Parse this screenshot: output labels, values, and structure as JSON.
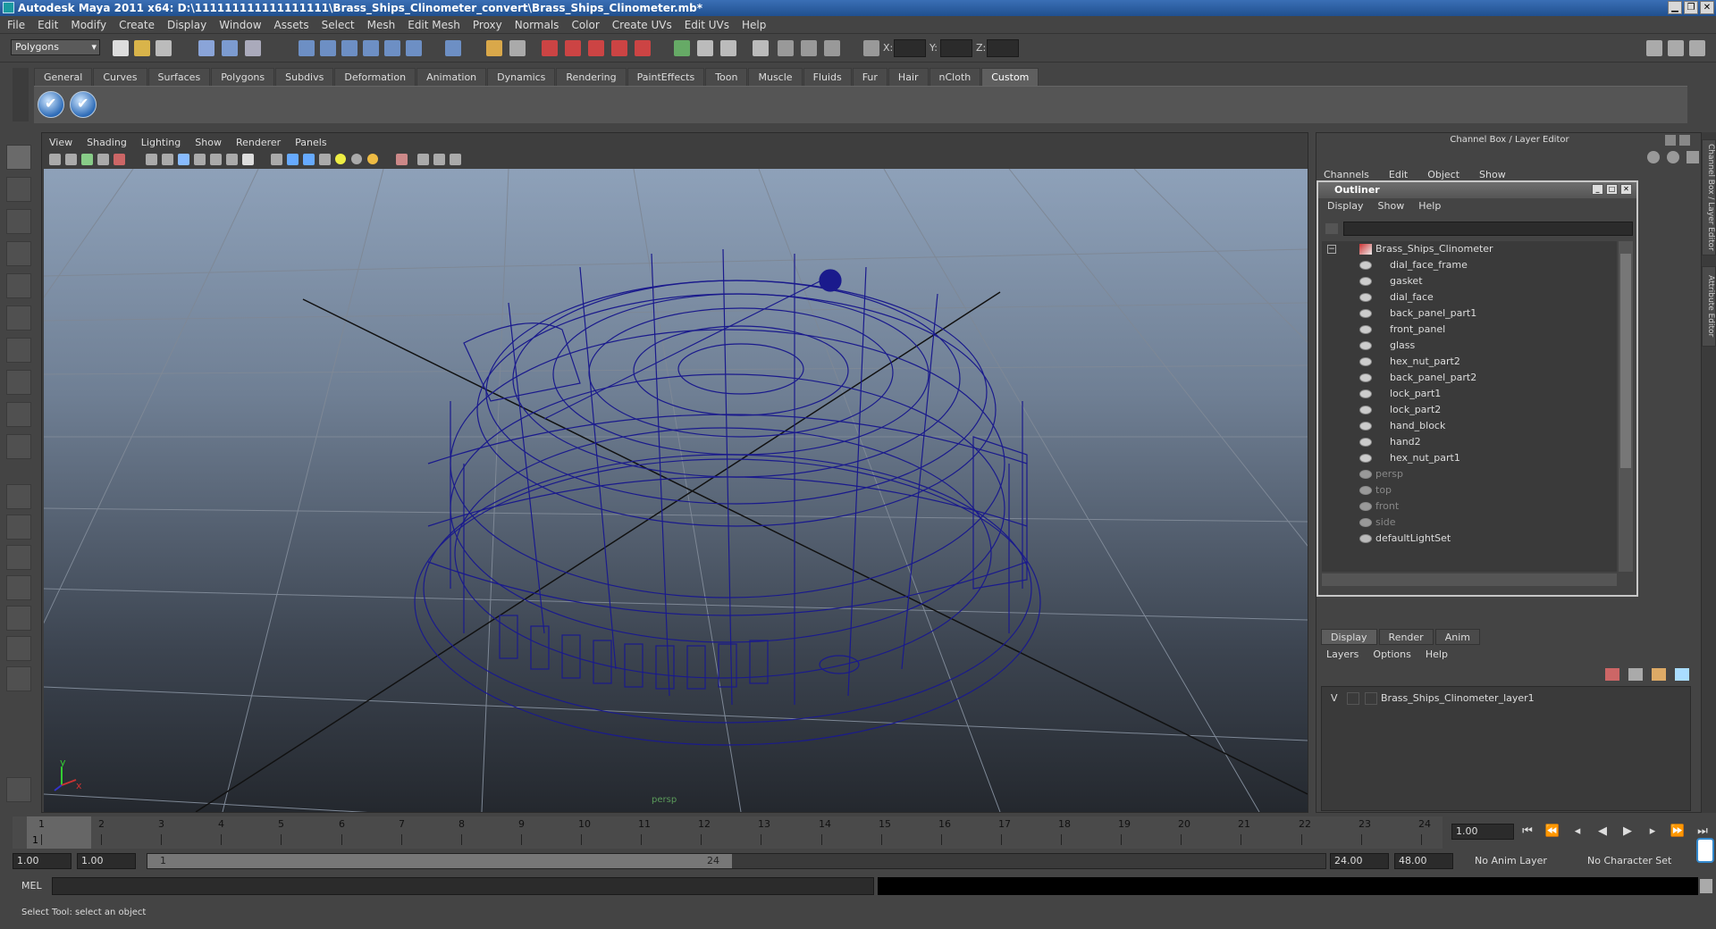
{
  "window": {
    "title": "Autodesk Maya 2011 x64: D:\\111111111111111111\\Brass_Ships_Clinometer_convert\\Brass_Ships_Clinometer.mb*"
  },
  "menubar": [
    "File",
    "Edit",
    "Modify",
    "Create",
    "Display",
    "Window",
    "Assets",
    "Select",
    "Mesh",
    "Edit Mesh",
    "Proxy",
    "Normals",
    "Color",
    "Create UVs",
    "Edit UVs",
    "Help"
  ],
  "status": {
    "mode": "Polygons",
    "x_label": "X:",
    "y_label": "Y:",
    "z_label": "Z:"
  },
  "shelf": {
    "tabs": [
      "General",
      "Curves",
      "Surfaces",
      "Polygons",
      "Subdivs",
      "Deformation",
      "Animation",
      "Dynamics",
      "Rendering",
      "PaintEffects",
      "Toon",
      "Muscle",
      "Fluids",
      "Fur",
      "Hair",
      "nCloth",
      "Custom"
    ],
    "active_tab": "Custom"
  },
  "viewport": {
    "menu": [
      "View",
      "Shading",
      "Lighting",
      "Show",
      "Renderer",
      "Panels"
    ],
    "camera": "persp",
    "axis_y": "y",
    "axis_x": "x",
    "wire_color": "#1a1a8c"
  },
  "channelbox": {
    "title": "Channel Box / Layer Editor",
    "menu": [
      "Channels",
      "Edit",
      "Object",
      "Show"
    ]
  },
  "sidetabs": [
    "Channel Box / Layer Editor",
    "Attribute Editor"
  ],
  "outliner": {
    "title": "Outliner",
    "menu": [
      "Display",
      "Show",
      "Help"
    ],
    "root": "Brass_Ships_Clinometer",
    "children": [
      "dial_face_frame",
      "gasket",
      "dial_face",
      "back_panel_part1",
      "front_panel",
      "glass",
      "hex_nut_part2",
      "back_panel_part2",
      "lock_part1",
      "lock_part2",
      "hand_block",
      "hand2",
      "hex_nut_part1"
    ],
    "cameras": [
      "persp",
      "top",
      "front",
      "side"
    ],
    "extra": "defaultLightSet"
  },
  "layer_editor": {
    "tabs": [
      "Display",
      "Render",
      "Anim"
    ],
    "active_tab": "Display",
    "menu": [
      "Layers",
      "Options",
      "Help"
    ],
    "layer": {
      "visible": "V",
      "name": "Brass_Ships_Clinometer_layer1"
    }
  },
  "timeline": {
    "ticks": [
      "1",
      "2",
      "3",
      "4",
      "5",
      "6",
      "7",
      "8",
      "9",
      "10",
      "11",
      "12",
      "13",
      "14",
      "15",
      "16",
      "17",
      "18",
      "19",
      "20",
      "21",
      "22",
      "23",
      "24"
    ],
    "current_frame": "1",
    "current_time": "1.00"
  },
  "range": {
    "start": "1.00",
    "inner_start": "1.00",
    "bar_start": "1",
    "bar_end": "24",
    "end": "24.00",
    "total_end": "48.00",
    "anim_layer": "No Anim Layer",
    "character_set": "No Character Set"
  },
  "command": {
    "label": "MEL"
  },
  "helpline": {
    "text": "Select Tool: select an object"
  }
}
